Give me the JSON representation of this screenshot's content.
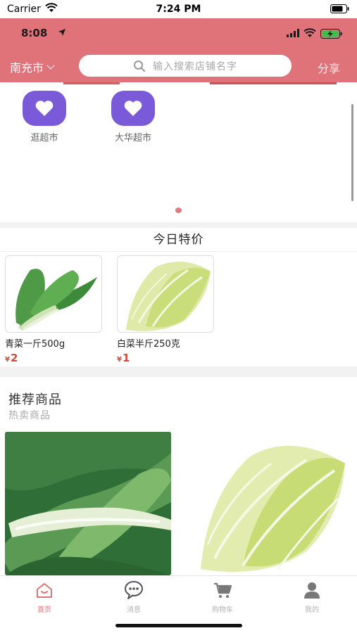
{
  "os_status": {
    "carrier": "Carrier",
    "time": "7:24 PM"
  },
  "app_status": {
    "time": "8:08"
  },
  "header": {
    "city": "南充市",
    "search_placeholder": "输入搜索店铺名字",
    "share_label": "分享",
    "accent_color": "#e0727a"
  },
  "stores": [
    {
      "label": "逛超市",
      "icon": "heart-icon"
    },
    {
      "label": "大华超市",
      "icon": "heart-icon"
    }
  ],
  "specials": {
    "title": "今日特价",
    "items": [
      {
        "name": "青菜一斤500g",
        "currency": "¥",
        "price": "2",
        "image": "bok-choy"
      },
      {
        "name": "白菜半斤250克",
        "currency": "¥",
        "price": "1",
        "image": "napa-cabbage"
      }
    ]
  },
  "recommend": {
    "title": "推荐商品",
    "subtitle": "热卖商品",
    "items": [
      {
        "image": "bok-choy"
      },
      {
        "image": "napa-cabbage"
      }
    ]
  },
  "tabs": [
    {
      "label": "首页",
      "icon": "home-icon",
      "active": true
    },
    {
      "label": "消息",
      "icon": "chat-icon",
      "active": false
    },
    {
      "label": "购物车",
      "icon": "cart-icon",
      "active": false
    },
    {
      "label": "我的",
      "icon": "user-icon",
      "active": false
    }
  ]
}
